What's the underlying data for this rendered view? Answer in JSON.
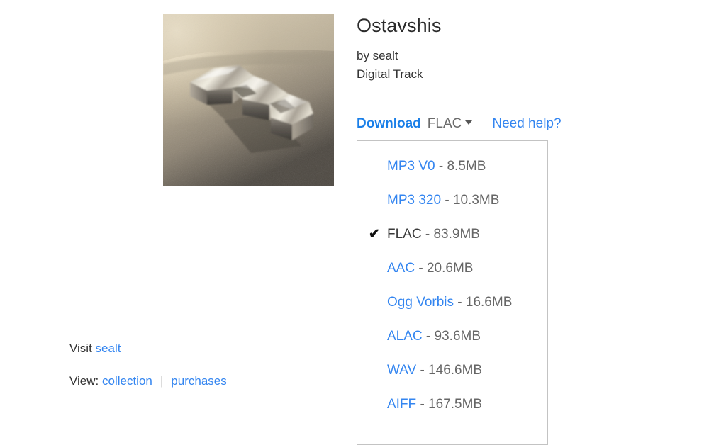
{
  "release": {
    "title": "Ostavshis",
    "artist_line": "by sealt",
    "type_line": "Digital Track",
    "artwork_alt": "chrome-lettering-on-concrete"
  },
  "download": {
    "label": "Download",
    "current_format": "FLAC",
    "caret_icon": "chevron-down-icon",
    "help_label": "Need help?"
  },
  "format_menu": {
    "check_icon": "✔",
    "options": [
      {
        "name": "MP3 V0",
        "separator": " - ",
        "size": "8.5MB",
        "selected": false
      },
      {
        "name": "MP3 320",
        "separator": " - ",
        "size": "10.3MB",
        "selected": false
      },
      {
        "name": "FLAC",
        "separator": " - ",
        "size": "83.9MB",
        "selected": true
      },
      {
        "name": "AAC",
        "separator": " - ",
        "size": "20.6MB",
        "selected": false
      },
      {
        "name": "Ogg Vorbis",
        "separator": " - ",
        "size": "16.6MB",
        "selected": false
      },
      {
        "name": "ALAC",
        "separator": " - ",
        "size": "93.6MB",
        "selected": false
      },
      {
        "name": "WAV",
        "separator": " - ",
        "size": "146.6MB",
        "selected": false
      },
      {
        "name": "AIFF",
        "separator": " - ",
        "size": "167.5MB",
        "selected": false
      }
    ]
  },
  "footer": {
    "visit_prefix": "Visit",
    "visit_link": "sealt",
    "view_prefix": "View:",
    "collection_link": "collection",
    "separator": "|",
    "purchases_link": "purchases"
  },
  "colors": {
    "link_blue": "#3385f0",
    "accent_blue": "#1a7fe8",
    "text_dark": "#333333",
    "text_muted": "#666666",
    "panel_border": "#c3c3c3"
  }
}
